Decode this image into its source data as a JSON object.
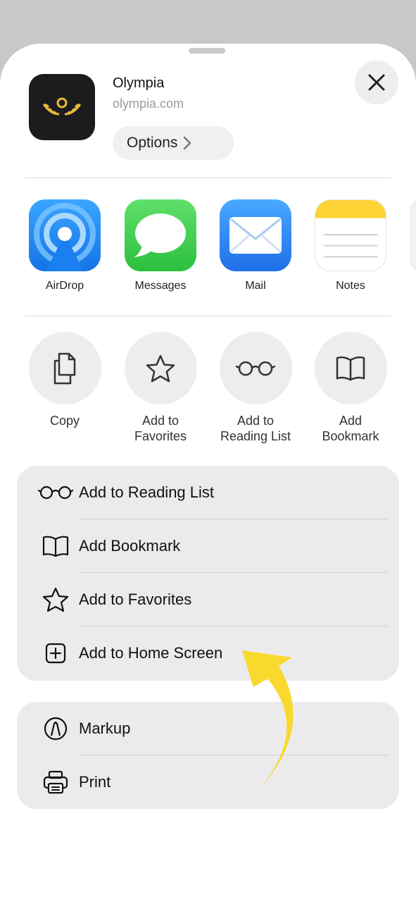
{
  "header": {
    "app_name": "Olympia",
    "app_url": "olympia.com",
    "options_label": "Options"
  },
  "share_apps": [
    {
      "label": "AirDrop",
      "icon": "airdrop-icon"
    },
    {
      "label": "Messages",
      "icon": "messages-icon"
    },
    {
      "label": "Mail",
      "icon": "mail-icon"
    },
    {
      "label": "Notes",
      "icon": "notes-icon"
    }
  ],
  "quick_actions": [
    {
      "label": "Copy",
      "icon": "copy-icon"
    },
    {
      "label": "Add to\nFavorites",
      "icon": "star-icon"
    },
    {
      "label": "Add to\nReading List",
      "icon": "glasses-icon"
    },
    {
      "label": "Add\nBookmark",
      "icon": "book-icon"
    }
  ],
  "menu_group_1": [
    {
      "label": "Add to Reading List",
      "icon": "glasses-icon"
    },
    {
      "label": "Add Bookmark",
      "icon": "book-icon"
    },
    {
      "label": "Add to Favorites",
      "icon": "star-icon"
    },
    {
      "label": "Add to Home Screen",
      "icon": "plus-square-icon"
    }
  ],
  "menu_group_2": [
    {
      "label": "Markup",
      "icon": "markup-icon"
    },
    {
      "label": "Print",
      "icon": "printer-icon"
    }
  ],
  "colors": {
    "arrow": "#f9d92e",
    "airdrop": "#1d8cf8",
    "messages": "#3ccf4e",
    "mail": "#2f86f5",
    "notes_top": "#fdd335",
    "logo_gold": "#e8b93a"
  }
}
